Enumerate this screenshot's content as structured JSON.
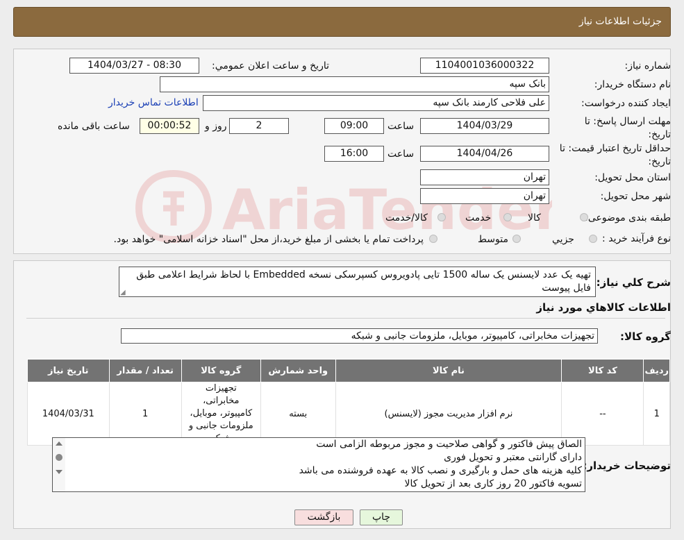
{
  "header": {
    "title": "جزئیات اطلاعات نیاز"
  },
  "fields": {
    "need_number_label": "شماره نیاز:",
    "need_number": "1104001036000322",
    "announce_label": "تاریخ و ساعت اعلان عمومي:",
    "announce_value": "1404/03/27 - 08:30",
    "buyer_label": "نام دستگاه خریدار:",
    "buyer": "بانک سپه",
    "creator_label": "ایجاد کننده درخواست:",
    "creator": "علی فلاحی کارمند بانک سپه",
    "buyer_contact_link": "اطلاعات تماس خریدار",
    "deadline_label": "مهلت ارسال پاسخ: تا تاریخ:",
    "deadline_date": "1404/03/29",
    "time_label": "ساعت",
    "deadline_time": "09:00",
    "days_value": "2",
    "days_label": "روز و",
    "remaining_time": "00:00:52",
    "remaining_label": "ساعت باقی مانده",
    "validity_label": "حداقل تاریخ اعتبار قیمت: تا تاریخ:",
    "validity_date": "1404/04/26",
    "validity_time": "16:00",
    "province_label": "استان محل تحویل:",
    "province": "تهران",
    "city_label": "شهر محل تحویل:",
    "city": "تهران",
    "category_label": "طبقه بندی موضوعی:",
    "category_options": [
      "کالا",
      "خدمت",
      "کالا/خدمت"
    ],
    "process_label": "نوع فرآیند خرید :",
    "process_options": [
      "جزیي",
      "متوسط"
    ],
    "payment_note": "پرداخت تمام یا بخشی از مبلغ خرید،از محل \"اسناد خزانه اسلامی\" خواهد بود."
  },
  "description": {
    "label": "شرح کلي نیاز:",
    "text": "تهیه یک عدد لایسنس یک ساله 1500 تایی پادویروس کسپرسکی نسخه Embedded با لحاظ شرایط اعلامی طبق فایل پیوست"
  },
  "goods": {
    "section_title": "اطلاعات کالاهاي مورد نیاز",
    "group_label": "گروه کالا:",
    "group_value": "تجهیزات مخابراتی، کامپیوتر، موبایل، ملزومات جانبی و شبکه",
    "columns": [
      "ردیف",
      "کد کالا",
      "نام کالا",
      "واحد شمارش",
      "گروه کالا",
      "تعداد / مقدار",
      "تاریخ نیاز"
    ],
    "rows": [
      [
        "1",
        "--",
        "نرم افزار مدیریت مجوز (لایسنس)",
        "بسته",
        "تجهیزات مخابراتی، کامپیوتر، موبایل، ملزومات جانبی و شبکه",
        "1",
        "1404/03/31"
      ]
    ]
  },
  "buyer_notes": {
    "label": "توضیحات خریدار:",
    "lines": [
      "الصاق پیش فاکتور و گواهی صلاحیت و مجوز مربوطه الزامی است",
      "دارای گارانتی معتبر و تحویل فوری",
      "کلیه هزینه های حمل و بارگیری و نصب کالا به عهده فروشنده می باشد",
      "تسویه فاکتور 20 روز کاری بعد از تحویل کالا"
    ]
  },
  "buttons": {
    "print": "چاپ",
    "back": "بازگشت"
  },
  "colors": {
    "header": "#8b6a3e",
    "back_button": "#f8dede",
    "print_button": "#e6f7dc",
    "link": "#1a3fb5"
  }
}
